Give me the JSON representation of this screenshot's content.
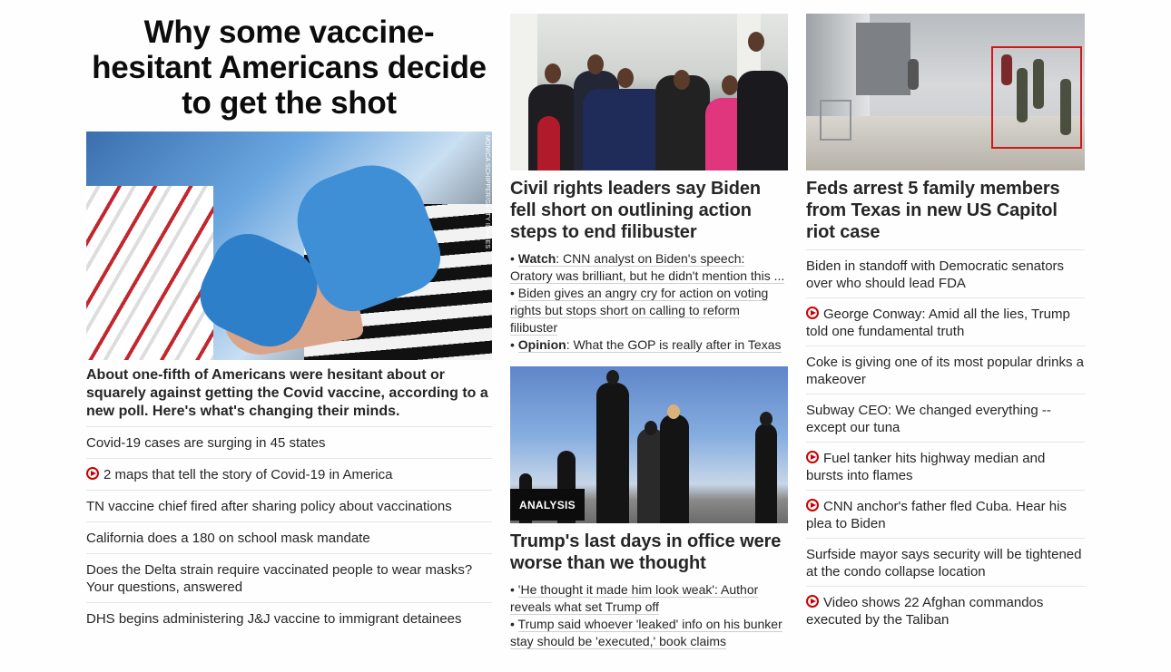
{
  "left": {
    "title": "Why some vaccine-hesitant Americans decide to get the shot",
    "image_credit": "MONICA SCHIPPER/GETTY IMAGES",
    "description": "About one-fifth of Americans were hesitant about or squarely against getting the Covid vaccine, according to a new poll. Here's what's changing their minds.",
    "links": [
      {
        "text": "Covid-19 cases are surging in 45 states",
        "video": false
      },
      {
        "text": "2 maps that tell the story of Covid-19 in America",
        "video": true
      },
      {
        "text": "TN vaccine chief fired after sharing policy about vaccinations",
        "video": false
      },
      {
        "text": "California does a 180 on school mask mandate",
        "video": false
      },
      {
        "text": "Does the Delta strain require vaccinated people to wear masks? Your questions, answered",
        "video": false
      },
      {
        "text": "DHS begins administering J&J vaccine to immigrant detainees",
        "video": false
      }
    ]
  },
  "middle": {
    "story1": {
      "headline": "Civil rights leaders say Biden fell short on outlining action steps to end filibuster",
      "bullets": [
        {
          "bold": "Watch",
          "text": ": CNN analyst on Biden's speech: Oratory was brilliant, but he didn't mention this ..."
        },
        {
          "bold": "",
          "text": "Biden gives an angry cry for action on voting rights but stops short on calling to reform filibuster"
        },
        {
          "bold": "Opinion",
          "text": ": What the GOP is really after in Texas"
        }
      ]
    },
    "story2": {
      "badge": "ANALYSIS",
      "headline": "Trump's last days in office were worse than we thought",
      "bullets": [
        {
          "text": "'He thought it made him look weak': Author reveals what set Trump off"
        },
        {
          "text": "Trump said whoever 'leaked' info on his bunker stay should be 'executed,' book claims"
        }
      ]
    }
  },
  "right": {
    "headline": "Feds arrest 5 family members from Texas in new US Capitol riot case",
    "links": [
      {
        "text": "Biden in standoff with Democratic senators over who should lead FDA",
        "video": false
      },
      {
        "text": "George Conway: Amid all the lies, Trump told one fundamental truth",
        "video": true
      },
      {
        "text": "Coke is giving one of its most popular drinks a makeover",
        "video": false
      },
      {
        "text": "Subway CEO: We changed everything -- except our tuna",
        "video": false
      },
      {
        "text": "Fuel tanker hits highway median and bursts into flames",
        "video": true
      },
      {
        "text": "CNN anchor's father fled Cuba. Hear his plea to Biden",
        "video": true
      },
      {
        "text": "Surfside mayor says security will be tightened at the condo collapse location",
        "video": false
      },
      {
        "text": "Video shows 22 Afghan commandos executed by the Taliban",
        "video": true
      }
    ]
  },
  "colors": {
    "video_icon": "#cc0000",
    "text": "#262626",
    "divider": "#e6e6e6",
    "badge_bg": "#0c0c0c"
  }
}
